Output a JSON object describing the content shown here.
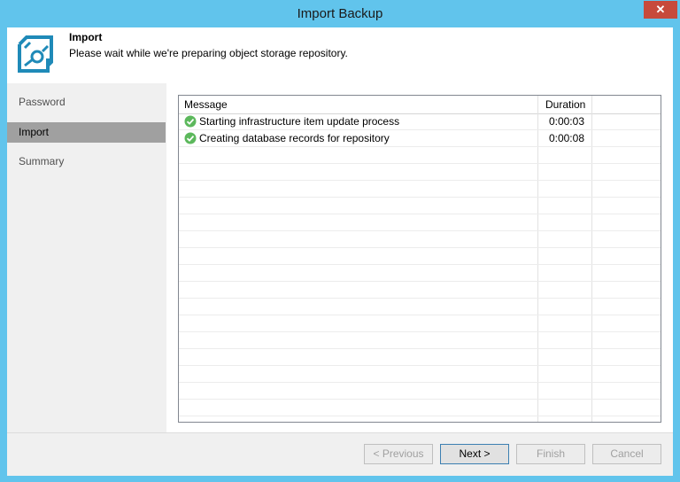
{
  "window": {
    "title": "Import Backup",
    "close_glyph": "✕"
  },
  "header": {
    "title": "Import",
    "subtitle": "Please wait while we're preparing object storage repository.",
    "icon": "backup-import-icon"
  },
  "nav": {
    "items": [
      {
        "label": "Password",
        "active": false
      },
      {
        "label": "Import",
        "active": true
      },
      {
        "label": "Summary",
        "active": false
      }
    ]
  },
  "log": {
    "columns": {
      "message": "Message",
      "duration": "Duration"
    },
    "rows": [
      {
        "status": "success",
        "message": "Starting infrastructure item update process",
        "duration": "0:00:03"
      },
      {
        "status": "success",
        "message": "Creating database records for repository",
        "duration": "0:00:08"
      }
    ]
  },
  "buttons": {
    "previous": "< Previous",
    "next": "Next >",
    "finish": "Finish",
    "cancel": "Cancel"
  },
  "colors": {
    "titlebar": "#61c4ec",
    "accent": "#1f8ab8",
    "success": "#5cb85c",
    "close": "#c74a3b"
  }
}
